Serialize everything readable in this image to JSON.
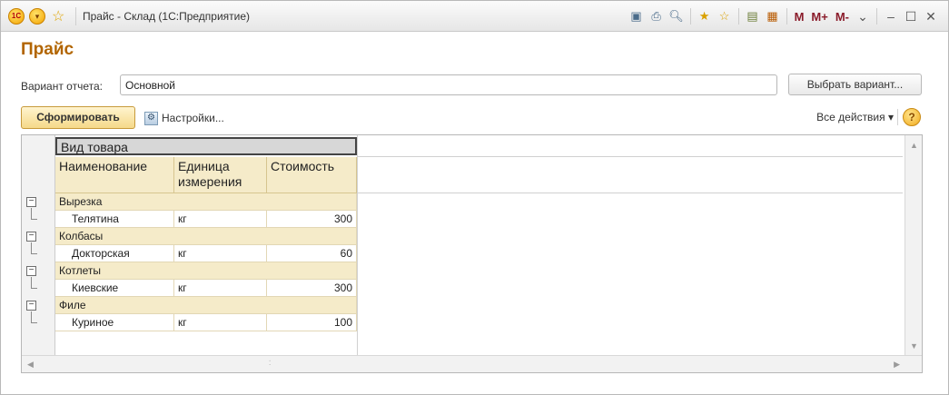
{
  "window": {
    "title": "Прайс - Склад  (1С:Предприятие)",
    "logo_text": "1С",
    "memory_buttons": [
      "M",
      "M+",
      "M-"
    ]
  },
  "form": {
    "title": "Прайс",
    "variant_label": "Вариант отчета:",
    "variant_value": "Основной",
    "choose_variant_button": "Выбрать вариант...",
    "generate_button": "Сформировать",
    "settings_button": "Настройки...",
    "all_actions": "Все действия ▾",
    "help": "?"
  },
  "report": {
    "group_header": "Вид товара",
    "columns": [
      "Наименование",
      "Единица измерения",
      "Стоимость"
    ],
    "groups": [
      {
        "name": "Вырезка",
        "item": "Телятина",
        "unit": "кг",
        "price": "300"
      },
      {
        "name": "Колбасы",
        "item": "Докторская",
        "unit": "кг",
        "price": "60"
      },
      {
        "name": "Котлеты",
        "item": "Киевские",
        "unit": "кг",
        "price": "300"
      },
      {
        "name": "Филе",
        "item": "Куриное",
        "unit": "кг",
        "price": "100"
      }
    ]
  },
  "colors": {
    "title_accent": "#b26500",
    "group_row_bg": "#f5ebc9",
    "generate_button_bg": "#f5d989"
  }
}
